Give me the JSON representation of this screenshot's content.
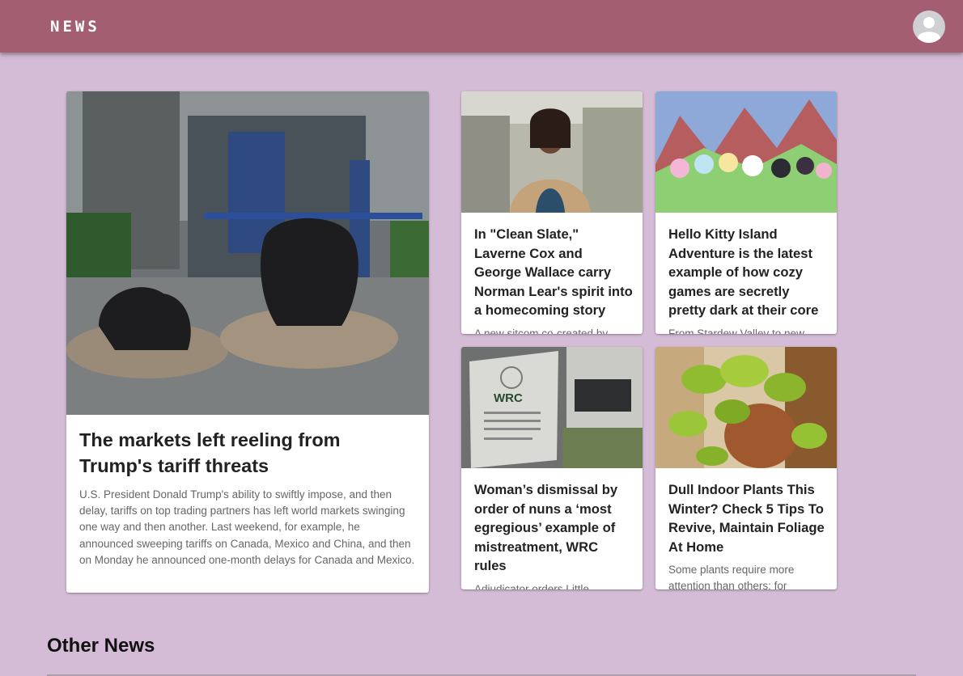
{
  "header": {
    "brand": "NEWS",
    "account_icon": "account-circle-icon",
    "color": "#a45e72"
  },
  "page": {
    "background": "#d5bcd6"
  },
  "featured": {
    "image": "stock-exchange-bull-statues-photo",
    "title": "The markets left reeling from Trump's tariff threats",
    "summary": "U.S. President Donald Trump's ability to swiftly impose, and then delay, tariffs on top trading partners has left world markets swinging one way and then another. Last weekend, for example, he announced sweeping tariffs on Canada, Mexico and China, and then on Monday he announced one-month delays for Canada and Mexico."
  },
  "articles": [
    {
      "image": "actress-portrait-photo",
      "title": "In \"Clean Slate,\" Laverne Cox and George Wallace carry Norman Lear's spirit into a homecoming story",
      "summary": "A new sitcom co-created by"
    },
    {
      "image": "hello-kitty-island-game-screenshot",
      "title": "Hello Kitty Island Adventure is the latest example of how cozy games are secretly pretty dark at their core",
      "summary": "From Stardew Valley to new"
    },
    {
      "image": "wrc-building-sign-photo",
      "title": "Woman’s dismissal by order of nuns a ‘most egregious’ example of mistreatment, WRC rules",
      "summary": "Adjudicator orders Little"
    },
    {
      "image": "pothos-houseplant-photo",
      "title": "Dull Indoor Plants This Winter? Check 5 Tips To Revive, Maintain Foliage At Home",
      "summary": "Some plants require more attention than others: for"
    }
  ],
  "other_news": {
    "heading": "Other News"
  }
}
